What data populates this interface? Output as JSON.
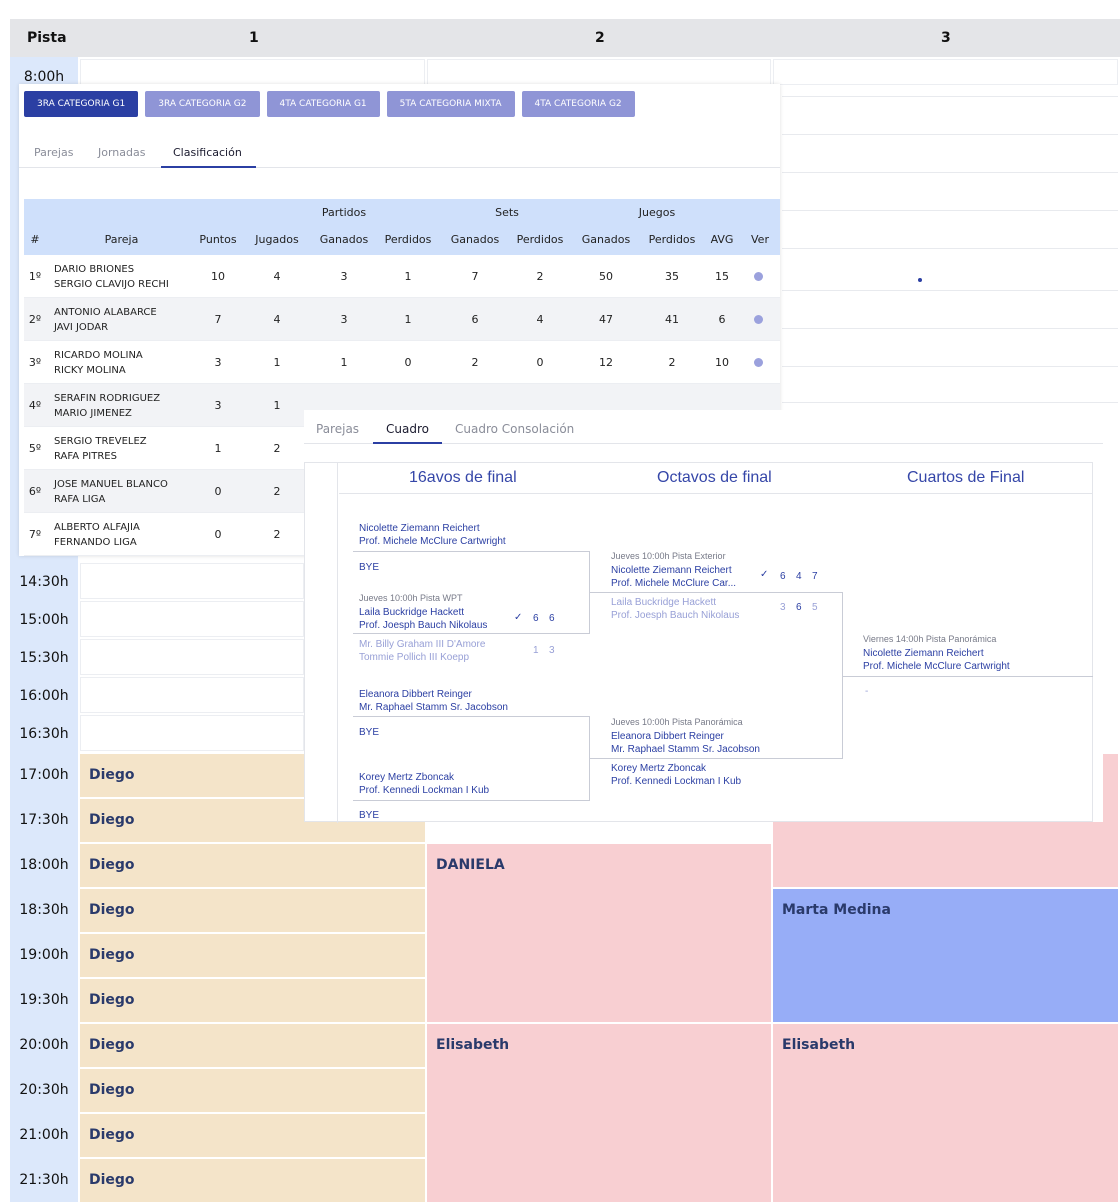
{
  "schedule": {
    "header": {
      "pista_label": "Pista",
      "courts": [
        "1",
        "2",
        "3"
      ]
    },
    "times": [
      "8:00h",
      "14:30h",
      "15:00h",
      "15:30h",
      "16:00h",
      "16:30h",
      "17:00h",
      "17:30h",
      "18:00h",
      "18:30h",
      "19:00h",
      "19:30h",
      "20:00h",
      "20:30h",
      "21:00h",
      "21:30h"
    ],
    "bookings": {
      "court1_name": "Diego",
      "daniela": "DANIELA",
      "elisabeth_2": "Elisabeth",
      "marta": "Marta Medina",
      "elisabeth_3": "Elisabeth"
    },
    "colors": {
      "diego": "#f4e4c9",
      "pink": "#f8cfd2",
      "blue": "#97adf7",
      "time_column": "#dce8fb"
    }
  },
  "standings": {
    "categories": [
      "3RA CATEGORIA G1",
      "3RA CATEGORIA G2",
      "4TA CATEGORIA G1",
      "5TA CATEGORIA MIXTA",
      "4TA CATEGORIA G2"
    ],
    "active_category": "3RA CATEGORIA G1",
    "tabs": [
      "Parejas",
      "Jornadas",
      "Clasificación"
    ],
    "active_tab": "Clasificación",
    "group_headers": {
      "partidos": "Partidos",
      "sets": "Sets",
      "juegos": "Juegos"
    },
    "columns": [
      "#",
      "Pareja",
      "Puntos",
      "Jugados",
      "Ganados",
      "Perdidos",
      "Ganados",
      "Perdidos",
      "Ganados",
      "Perdidos",
      "AVG",
      "Ver"
    ],
    "rows": [
      {
        "pos": "1º",
        "p1": "DARIO BRIONES",
        "p2": "SERGIO CLAVIJO RECHI",
        "puntos": "10",
        "jugados": "4",
        "pg": "3",
        "pp": "1",
        "sg": "7",
        "sp": "2",
        "jg": "50",
        "jp": "35",
        "avg": "15"
      },
      {
        "pos": "2º",
        "p1": "ANTONIO ALABARCE",
        "p2": "JAVI JODAR",
        "puntos": "7",
        "jugados": "4",
        "pg": "3",
        "pp": "1",
        "sg": "6",
        "sp": "4",
        "jg": "47",
        "jp": "41",
        "avg": "6"
      },
      {
        "pos": "3º",
        "p1": "RICARDO MOLINA",
        "p2": "RICKY MOLINA",
        "puntos": "3",
        "jugados": "1",
        "pg": "1",
        "pp": "0",
        "sg": "2",
        "sp": "0",
        "jg": "12",
        "jp": "2",
        "avg": "10"
      },
      {
        "pos": "4º",
        "p1": "SERAFIN RODRIGUEZ",
        "p2": "MARIO JIMENEZ",
        "puntos": "3",
        "jugados": "1"
      },
      {
        "pos": "5º",
        "p1": "SERGIO TREVELEZ",
        "p2": "RAFA PITRES",
        "puntos": "1",
        "jugados": "2"
      },
      {
        "pos": "6º",
        "p1": "JOSE MANUEL BLANCO",
        "p2": "RAFA LIGA",
        "puntos": "0",
        "jugados": "2"
      },
      {
        "pos": "7º",
        "p1": "ALBERTO ALFAJIA",
        "p2": "FERNANDO LIGA",
        "puntos": "0",
        "jugados": "2"
      }
    ]
  },
  "bracket": {
    "tabs": [
      "Parejas",
      "Cuadro",
      "Cuadro Consolación"
    ],
    "active_tab": "Cuadro",
    "rounds": [
      "16avos de final",
      "Octavos de final",
      "Cuartos de Final"
    ],
    "r16": [
      {
        "a1": "Nicolette Ziemann Reichert",
        "a2": "Prof. Michele McClure Cartwright",
        "b": "BYE"
      },
      {
        "meta": "Jueves 10:00h Pista WPT",
        "a1": "Laila Buckridge Hackett",
        "a2": "Prof. Joesph Bauch Nikolaus",
        "a_check": "✓",
        "a_s1": "6",
        "a_s2": "6",
        "b1": "Mr. Billy Graham III D'Amore",
        "b2": "Tommie Pollich III Koepp",
        "b_s1": "1",
        "b_s2": "3"
      },
      {
        "a1": "Eleanora Dibbert Reinger",
        "a2": "Mr. Raphael Stamm Sr. Jacobson",
        "b": "BYE"
      },
      {
        "a1": "Korey Mertz Zboncak",
        "a2": "Prof. Kennedi Lockman I Kub",
        "b": "BYE"
      }
    ],
    "r8": [
      {
        "meta": "Jueves 10:00h Pista Exterior",
        "a1": "Nicolette Ziemann Reichert",
        "a2": "Prof. Michele McClure Car...",
        "a_check": "✓",
        "a_s1": "6",
        "a_s2": "4",
        "a_s3": "7",
        "b1": "Laila Buckridge Hackett",
        "b2": "Prof. Joesph Bauch Nikolaus",
        "b_s1": "3",
        "b_s2": "6",
        "b_s3": "5"
      },
      {
        "meta": "Jueves 10:00h Pista Panorámica",
        "a1": "Eleanora Dibbert Reinger",
        "a2": "Mr. Raphael Stamm Sr. Jacobson",
        "b1": "Korey Mertz Zboncak",
        "b2": "Prof. Kennedi Lockman I Kub"
      }
    ],
    "qf": [
      {
        "meta": "Viernes 14:00h Pista Panorámica",
        "a1": "Nicolette Ziemann Reichert",
        "a2": "Prof. Michele McClure Cartwright",
        "b": "-"
      }
    ]
  }
}
